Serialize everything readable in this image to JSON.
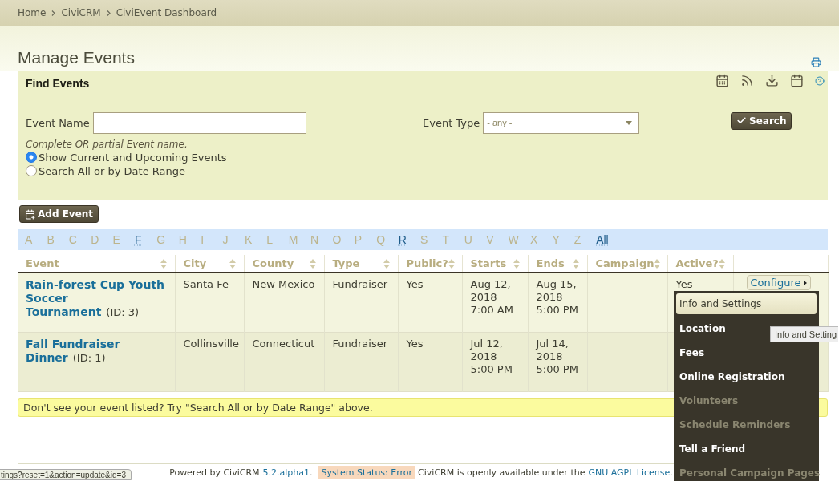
{
  "breadcrumb": [
    "Home",
    "CiviCRM",
    "CiviEvent Dashboard"
  ],
  "page_title": "Manage Events",
  "find_panel": {
    "title": "Find Events",
    "event_name": {
      "label": "Event Name",
      "hint": "Complete OR partial Event name."
    },
    "event_type": {
      "label": "Event Type",
      "value": "- any -"
    },
    "search_button": "Search",
    "date_options": [
      {
        "label": "Show Current and Upcoming Events",
        "selected": true
      },
      {
        "label": "Search All or by Date Range",
        "selected": false
      }
    ]
  },
  "add_event_button": "Add Event",
  "alphabet": [
    {
      "label": "A",
      "enabled": false
    },
    {
      "label": "B",
      "enabled": false
    },
    {
      "label": "C",
      "enabled": false
    },
    {
      "label": "D",
      "enabled": false
    },
    {
      "label": "E",
      "enabled": false
    },
    {
      "label": "F",
      "enabled": true
    },
    {
      "label": "G",
      "enabled": false
    },
    {
      "label": "H",
      "enabled": false
    },
    {
      "label": "I",
      "enabled": false
    },
    {
      "label": "J",
      "enabled": false
    },
    {
      "label": "K",
      "enabled": false
    },
    {
      "label": "L",
      "enabled": false
    },
    {
      "label": "M",
      "enabled": false
    },
    {
      "label": "N",
      "enabled": false
    },
    {
      "label": "O",
      "enabled": false
    },
    {
      "label": "P",
      "enabled": false
    },
    {
      "label": "Q",
      "enabled": false
    },
    {
      "label": "R",
      "enabled": true
    },
    {
      "label": "S",
      "enabled": false
    },
    {
      "label": "T",
      "enabled": false
    },
    {
      "label": "U",
      "enabled": false
    },
    {
      "label": "V",
      "enabled": false
    },
    {
      "label": "W",
      "enabled": false
    },
    {
      "label": "X",
      "enabled": false
    },
    {
      "label": "Y",
      "enabled": false
    },
    {
      "label": "Z",
      "enabled": false
    },
    {
      "label": "All",
      "enabled": true
    }
  ],
  "table": {
    "columns": [
      "Event",
      "City",
      "County",
      "Type",
      "Public?",
      "Starts",
      "Ends",
      "Campaign",
      "Active?"
    ],
    "rows": [
      {
        "event": "Rain-forest Cup Youth Soccer Tournament",
        "id": "(ID: 3)",
        "city": "Santa Fe",
        "county": "New Mexico",
        "type": "Fundraiser",
        "public": "Yes",
        "starts": "Aug 12, 2018 7:00 AM",
        "ends": "Aug 15, 2018 5:00 PM",
        "campaign": "",
        "active": "Yes",
        "action": "Configure"
      },
      {
        "event": "Fall Fundraiser Dinner",
        "id": "(ID: 1)",
        "city": "Collinsville",
        "county": "Connecticut",
        "type": "Fundraiser",
        "public": "Yes",
        "starts": "Jul 12, 2018 5:00 PM",
        "ends": "Jul 14, 2018 5:00 PM",
        "campaign": "",
        "active": "",
        "action": ""
      }
    ]
  },
  "configure_menu": [
    {
      "label": "Info and Settings",
      "highlighted": true,
      "disabled": false
    },
    {
      "label": "Location",
      "highlighted": false,
      "disabled": false
    },
    {
      "label": "Fees",
      "highlighted": false,
      "disabled": false
    },
    {
      "label": "Online Registration",
      "highlighted": false,
      "disabled": false
    },
    {
      "label": "Volunteers",
      "highlighted": false,
      "disabled": true
    },
    {
      "label": "Schedule Reminders",
      "highlighted": false,
      "disabled": true
    },
    {
      "label": "Tell a Friend",
      "highlighted": false,
      "disabled": false
    },
    {
      "label": "Personal Campaign Pages",
      "highlighted": false,
      "disabled": true
    }
  ],
  "tooltip": "Info and Setting",
  "notice": "Don't see your event listed? Try \"Search All or by Date Range\" above.",
  "footer": [
    {
      "kind": "text",
      "text": "Powered by CiviCRM"
    },
    {
      "kind": "link",
      "text": "5.2.alpha1"
    },
    {
      "kind": "text",
      "text": "."
    },
    {
      "kind": "status",
      "text": "System Status: Error"
    },
    {
      "kind": "text",
      "text": "CiviCRM is openly available under the"
    },
    {
      "kind": "link",
      "text": "GNU AGPL License"
    },
    {
      "kind": "text",
      "text": "."
    }
  ],
  "status_url": "tings?reset=1&action=update&id=3"
}
